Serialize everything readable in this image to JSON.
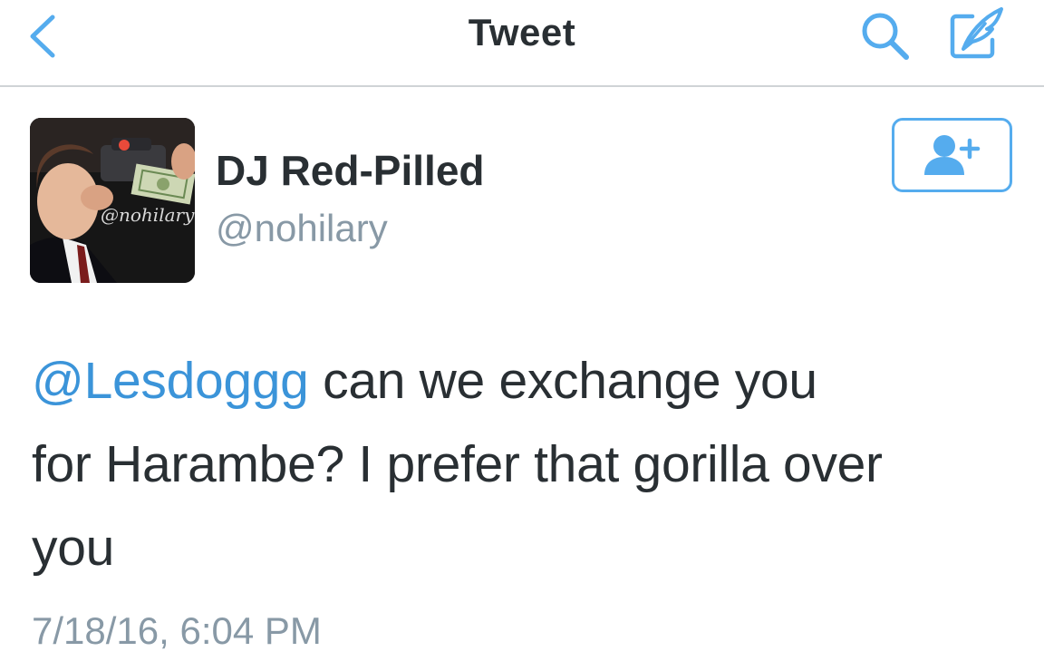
{
  "nav": {
    "title": "Tweet",
    "back_icon": "chevron-left-icon",
    "search_icon": "search-icon",
    "compose_icon": "compose-tweet-icon"
  },
  "author": {
    "display_name": "DJ Red-Pilled",
    "screen_name": "@nohilary",
    "avatar_watermark": "@nohilary",
    "follow_icon": "add-user-icon"
  },
  "tweet": {
    "mention": "@Lesdoggg",
    "text_line_1": " can we exchange you",
    "text_line_2": "for Harambe? I prefer that gorilla over",
    "text_line_3": "you",
    "timestamp": "7/18/16, 6:04 PM"
  },
  "colors": {
    "accent": "#55acee",
    "mention": "#3b94d9",
    "text": "#292f33",
    "secondary_text": "#8899a6",
    "divider": "#cfd3d6"
  }
}
